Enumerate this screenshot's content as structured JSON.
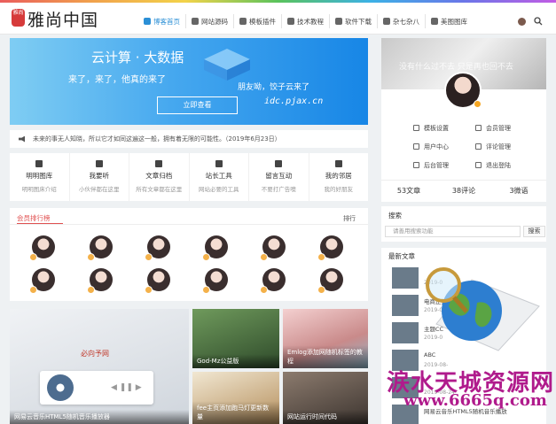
{
  "header": {
    "logo_seal": "雅尚",
    "logo_text": "雅尚中国",
    "nav": [
      {
        "label": "博客首页",
        "icon": "home-icon",
        "active": true
      },
      {
        "label": "网站源码",
        "icon": "globe-icon",
        "active": false
      },
      {
        "label": "模板插件",
        "icon": "template-icon",
        "active": false
      },
      {
        "label": "技术教程",
        "icon": "compass-icon",
        "active": false
      },
      {
        "label": "软件下载",
        "icon": "download-icon",
        "active": false
      },
      {
        "label": "杂七杂八",
        "icon": "dots-icon",
        "active": false
      },
      {
        "label": "美图图库",
        "icon": "image-icon",
        "active": false
      }
    ]
  },
  "banner": {
    "title": "云计算 · 大数据",
    "subtitle": "来了，来了，他真的来了",
    "button": "立即查看",
    "right_text": "朋友呦，饺子云来了",
    "url": "idc.pjax.cn"
  },
  "profile": {
    "bg_text": "没有什么过不去 只是再也回不去",
    "menu": [
      [
        "模板设置",
        "会员管理"
      ],
      [
        "用户中心",
        "评论管理"
      ],
      [
        "后台管理",
        "退出登陆"
      ]
    ],
    "stats": [
      "53文章",
      "38评论",
      "3微语"
    ]
  },
  "notice": {
    "text": "未来的事无人知晓，所以它才如同这遍这一般，拥有着无限的可能性。（2019年6月23日）"
  },
  "features": [
    {
      "title": "明明图库",
      "desc": "明明图床介绍"
    },
    {
      "title": "我要听",
      "desc": "小伙伴都在这里"
    },
    {
      "title": "文章归档",
      "desc": "所有文章都在这里"
    },
    {
      "title": "站长工具",
      "desc": "网站必要的工具"
    },
    {
      "title": "留言互动",
      "desc": "不要打广告噢"
    },
    {
      "title": "我的邻居",
      "desc": "我的好朋友"
    }
  ],
  "rank": {
    "title": "会员排行榜",
    "more": "排行"
  },
  "cards": [
    {
      "caption": "网易云音乐HTML5随机音乐播放器",
      "color": "#d9dde3"
    },
    {
      "caption": "God-Mz公益版",
      "color": "#3f6b3a"
    },
    {
      "caption": "Emlog添加网随机标签的教程",
      "color": "#e3b9b9"
    },
    {
      "caption": "fee主页添加跑马灯更新数量",
      "color": "#caa16a"
    },
    {
      "caption": "网站运行时间代码",
      "color": "#64584f"
    }
  ],
  "music_widget": {
    "brand": "必向予网"
  },
  "side_search": {
    "title": "搜索",
    "placeholder": "请善用搜索功能",
    "button": "搜索"
  },
  "side_posts": {
    "title": "最新文章",
    "items": [
      {
        "title": "",
        "date": "2019-0"
      },
      {
        "title": "电商正打入",
        "date": "2019-0"
      },
      {
        "title": "主题CC",
        "date": "2019-0"
      },
      {
        "title": "ABC",
        "date": "2019-08-"
      },
      {
        "title": "",
        "date": "2019-08-24"
      },
      {
        "title": "网易云音乐HTML5随机音乐播放",
        "date": ""
      }
    ]
  },
  "watermark": {
    "line1": "涙水天城资源网",
    "line2": "www.6665q.com"
  }
}
